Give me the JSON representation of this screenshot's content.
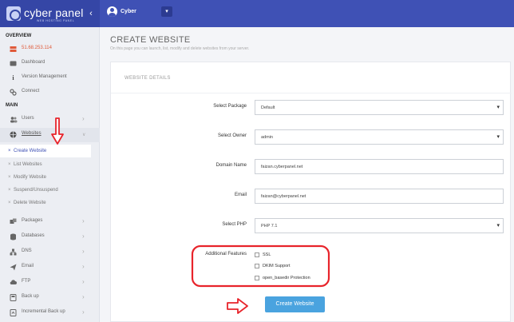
{
  "app": {
    "logo_text": "cyber panel",
    "logo_sub": "WEB HOSTING PANEL",
    "collapse_glyph": "‹",
    "user_name": "Cyber",
    "user_drop_glyph": "▾"
  },
  "sidebar": {
    "overview_heading": "OVERVIEW",
    "ip": "51.68.253.114",
    "top_items": [
      {
        "label": "Dashboard",
        "icon": "dashboard-icon"
      },
      {
        "label": "Version Management",
        "icon": "info-icon"
      },
      {
        "label": "Connect",
        "icon": "link-icon"
      }
    ],
    "main_heading": "MAIN",
    "users": {
      "label": "Users",
      "icon": "users-icon"
    },
    "websites": {
      "label": "Websites",
      "icon": "globe-icon"
    },
    "website_sub": [
      {
        "label": "Create Website",
        "active": true
      },
      {
        "label": "List Websites"
      },
      {
        "label": "Modify Website"
      },
      {
        "label": "Suspend/Unsuspend"
      },
      {
        "label": "Delete Website"
      }
    ],
    "bottom_items": [
      {
        "label": "Packages",
        "icon": "packages-icon"
      },
      {
        "label": "Databases",
        "icon": "database-icon"
      },
      {
        "label": "DNS",
        "icon": "dns-icon"
      },
      {
        "label": "Email",
        "icon": "email-icon"
      },
      {
        "label": "FTP",
        "icon": "ftp-icon"
      },
      {
        "label": "Back up",
        "icon": "backup-icon"
      },
      {
        "label": "Incremental Back up",
        "icon": "incremental-backup-icon"
      }
    ],
    "chevron": "›"
  },
  "main": {
    "title": "CREATE WEBSITE",
    "description": "On this page you can launch, list, modify and delete websites from your server.",
    "card_title": "WEBSITE DETAILS",
    "fields": {
      "package": {
        "label": "Select Package",
        "value": "Default"
      },
      "owner": {
        "label": "Select Owner",
        "value": "admin"
      },
      "domain": {
        "label": "Domain Name",
        "value": "faizan.cyberpanel.net"
      },
      "email": {
        "label": "Email",
        "value": "faizan@cyberpanel.net"
      },
      "php": {
        "label": "Select PHP",
        "value": "PHP 7.1"
      }
    },
    "caret": "▾",
    "additional_label": "Additional Features",
    "features": [
      "SSL",
      "DKIM Support",
      "open_basedir Protection"
    ],
    "create_button": "Create Website"
  },
  "colors": {
    "topbar": "#3f51b5",
    "annotation": "#e8242b",
    "button": "#4aa3df"
  }
}
